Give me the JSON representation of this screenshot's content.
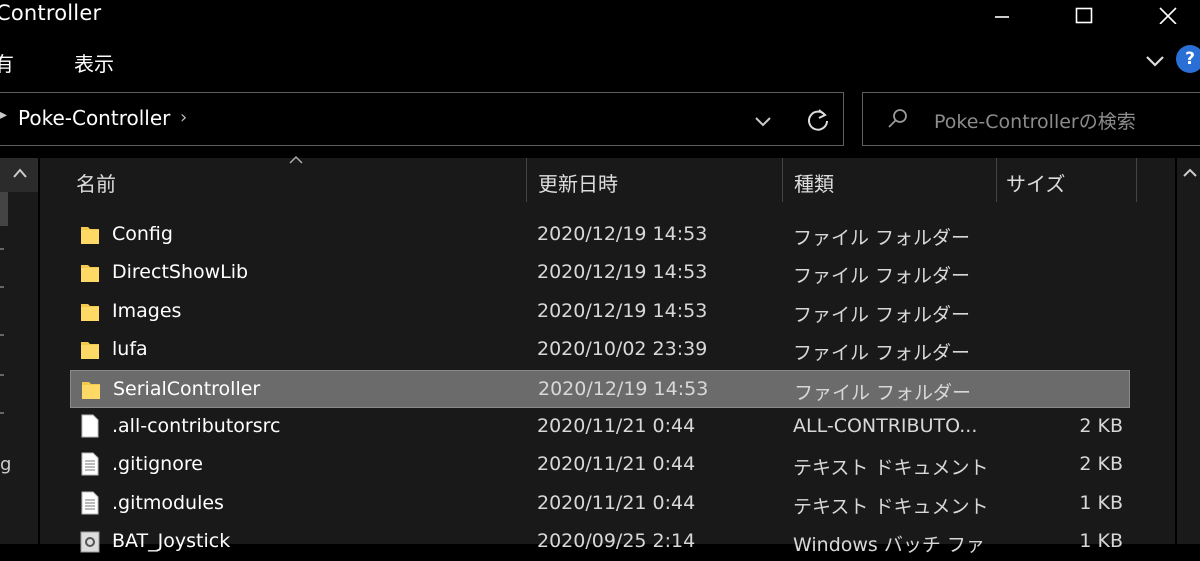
{
  "window": {
    "title": "Controller"
  },
  "ribbon": {
    "tabs": [
      "有",
      "表示"
    ]
  },
  "address": {
    "path": "Poke-Controller",
    "separator": "›"
  },
  "search": {
    "placeholder": "Poke-Controllerの検索"
  },
  "help": {
    "label": "?"
  },
  "columns": {
    "name": "名前",
    "date": "更新日時",
    "type": "種類",
    "size": "サイズ"
  },
  "nav": {
    "partial_letter": "g"
  },
  "files": [
    {
      "name": "Config",
      "date": "2020/12/19 14:53",
      "type": "ファイル フォルダー",
      "size": "",
      "icon": "folder-icon",
      "selected": false
    },
    {
      "name": "DirectShowLib",
      "date": "2020/12/19 14:53",
      "type": "ファイル フォルダー",
      "size": "",
      "icon": "folder-icon",
      "selected": false
    },
    {
      "name": "Images",
      "date": "2020/12/19 14:53",
      "type": "ファイル フォルダー",
      "size": "",
      "icon": "folder-icon",
      "selected": false
    },
    {
      "name": "lufa",
      "date": "2020/10/02 23:39",
      "type": "ファイル フォルダー",
      "size": "",
      "icon": "folder-icon",
      "selected": false
    },
    {
      "name": "SerialController",
      "date": "2020/12/19 14:53",
      "type": "ファイル フォルダー",
      "size": "",
      "icon": "folder-icon",
      "selected": true
    },
    {
      "name": ".all-contributorsrc",
      "date": "2020/11/21 0:44",
      "type": "ALL-CONTRIBUTO...",
      "size": "2 KB",
      "icon": "blank-file-icon",
      "selected": false
    },
    {
      "name": ".gitignore",
      "date": "2020/11/21 0:44",
      "type": "テキスト ドキュメント",
      "size": "2 KB",
      "icon": "text-file-icon",
      "selected": false
    },
    {
      "name": ".gitmodules",
      "date": "2020/11/21 0:44",
      "type": "テキスト ドキュメント",
      "size": "1 KB",
      "icon": "text-file-icon",
      "selected": false
    },
    {
      "name": "BAT_Joystick",
      "date": "2020/09/25 2:14",
      "type": "Windows バッチ ファ",
      "size": "1 KB",
      "icon": "batch-file-icon",
      "selected": false
    }
  ],
  "colors": {
    "folder": "#f2c94c",
    "selected": "#6b6b6b",
    "accent": "#2a6fd6"
  }
}
